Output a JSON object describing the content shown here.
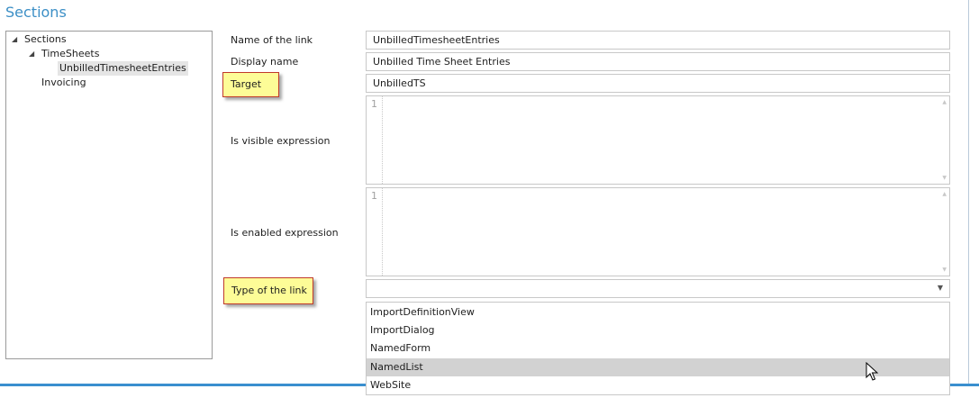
{
  "header": {
    "title": "Sections"
  },
  "tree": {
    "items": [
      {
        "label": "Sections",
        "expanded": true
      },
      {
        "label": "TimeSheets",
        "expanded": true
      },
      {
        "label": "UnbilledTimesheetEntries",
        "selected": true
      },
      {
        "label": "Invoicing"
      }
    ]
  },
  "form": {
    "name_of_link": {
      "label": "Name of the link",
      "value": "UnbilledTimesheetEntries"
    },
    "display_name": {
      "label": "Display name",
      "value": "Unbilled Time Sheet Entries"
    },
    "target": {
      "label": "Target",
      "value": "UnbilledTS"
    },
    "is_visible": {
      "label": "Is visible expression",
      "line_number": "1"
    },
    "is_enabled": {
      "label": "Is enabled expression",
      "line_number": "1"
    },
    "type_of_link": {
      "label": "Type of the link",
      "value": "",
      "options": [
        "ImportDefinitionView",
        "ImportDialog",
        "NamedForm",
        "NamedList",
        "WebSite"
      ],
      "highlighted": "NamedList"
    }
  },
  "colors": {
    "accent": "#3c8fc6",
    "callout": "#fdfc97",
    "callout_border": "#c0392b"
  }
}
